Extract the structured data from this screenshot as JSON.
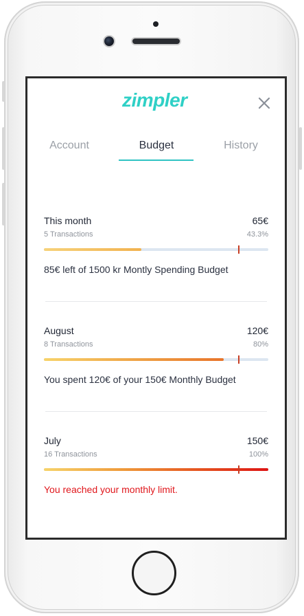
{
  "app": {
    "logo": "zimpler"
  },
  "tabs": [
    {
      "label": "Account",
      "active": false
    },
    {
      "label": "Budget",
      "active": true
    },
    {
      "label": "History",
      "active": false
    }
  ],
  "colors": {
    "accent": "#2fd0c6",
    "warning": "#e0161b",
    "track": "#dce6f1",
    "marker": "#c73e24"
  },
  "icons": {
    "close": "close-icon"
  },
  "budgets": [
    {
      "period": "This month",
      "amount": "65€",
      "transactions": "5 Transactions",
      "percent_label": "43.3%",
      "progress": 0.433,
      "limit_marker": 0.865,
      "note": "85€ left of 1500 kr Montly Spending Budget"
    },
    {
      "period": "August",
      "amount": "120€",
      "transactions": "8 Transactions",
      "percent_label": "80%",
      "progress": 0.8,
      "limit_marker": 0.865,
      "note": "You spent 120€ of your 150€ Monthly Budget"
    },
    {
      "period": "July",
      "amount": "150€",
      "transactions": "16 Transactions",
      "percent_label": "100%",
      "progress": 1.0,
      "limit_marker": 0.865,
      "note": "You reached your monthly limit."
    }
  ]
}
